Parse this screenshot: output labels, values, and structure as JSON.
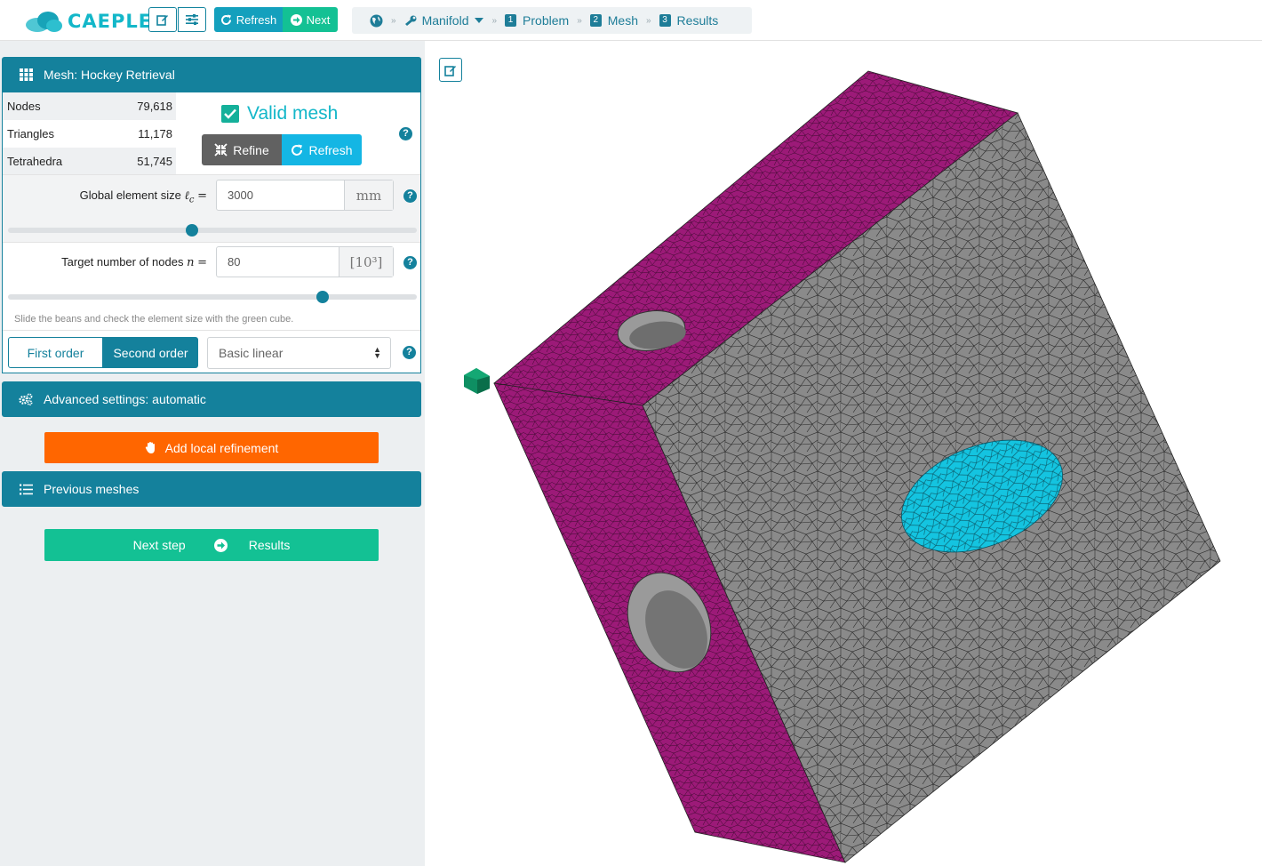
{
  "app": {
    "logo_text": "CAEPLEX",
    "brand_color": "#13b7c9",
    "accent_color": "#14819c"
  },
  "toolbar": {
    "edit_icon": "edit-icon",
    "settings_icon": "sliders-icon",
    "refresh_label": "Refresh",
    "next_label": "Next"
  },
  "breadcrumb": {
    "home_icon": "globe-icon",
    "manifold_label": "Manifold",
    "steps": [
      {
        "num": "1",
        "label": "Problem"
      },
      {
        "num": "2",
        "label": "Mesh"
      },
      {
        "num": "3",
        "label": "Results"
      }
    ]
  },
  "mesh_panel": {
    "title": "Mesh: Hockey Retrieval",
    "stats": [
      {
        "label": "Nodes",
        "value": "79,618"
      },
      {
        "label": "Triangles",
        "value": "11,178"
      },
      {
        "label": "Tetrahedra",
        "value": "51,745"
      }
    ],
    "status": "Valid mesh",
    "refine_label": "Refine",
    "refresh_label": "Refresh",
    "element_size": {
      "label": "Global element size",
      "symbol": "ℓ",
      "subscript": "c",
      "eq": "=",
      "value": "3000",
      "unit": "mm",
      "slider_fraction": 0.45
    },
    "target_nodes": {
      "label": "Target number of nodes",
      "symbol": "n",
      "eq": "=",
      "value": "80",
      "unit": "[10³]",
      "slider_fraction": 0.77
    },
    "hint": "Slide the beans and check the element size with the green cube.",
    "order_first": "First order",
    "order_second": "Second order",
    "element_type": "Basic linear"
  },
  "advanced": {
    "title": "Advanced settings: automatic"
  },
  "local_refinement": {
    "label": "Add local refinement"
  },
  "previous": {
    "title": "Previous meshes"
  },
  "next_step": {
    "label": "Next step",
    "target": "Results"
  },
  "viewer": {
    "edit_icon": "edit-icon",
    "colors": {
      "magenta_face": "#9c1a78",
      "grey_face": "#8a8a8a",
      "hole_highlight": "#14c4e0",
      "size_cube": "#0e8f62"
    }
  }
}
